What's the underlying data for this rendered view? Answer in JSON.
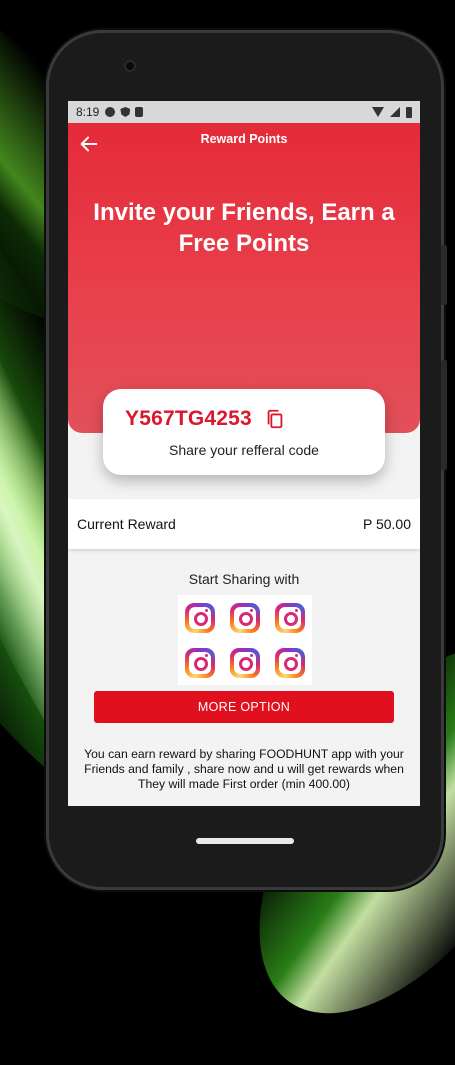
{
  "status_bar": {
    "time": "8:19"
  },
  "header": {
    "title": "Reward Points"
  },
  "hero": {
    "headline": "Invite your Friends, Earn a Free Points"
  },
  "referral": {
    "code": "Y567TG4253",
    "label": "Share your refferal code"
  },
  "reward": {
    "label": "Current Reward",
    "value": "P 50.00"
  },
  "sharing": {
    "title": "Start Sharing with",
    "apps": [
      "instagram-icon",
      "instagram-icon",
      "instagram-icon",
      "instagram-icon",
      "instagram-icon",
      "instagram-icon"
    ]
  },
  "more_button": {
    "label": "MORE OPTION"
  },
  "info": {
    "text": "You can earn reward by sharing FOODHUNT app with your Friends and family , share now and u will get rewards when They will made First order (min 400.00)"
  },
  "colors": {
    "primary_red": "#e52a38",
    "button_red": "#e0101f",
    "code_red": "#d9182b"
  }
}
